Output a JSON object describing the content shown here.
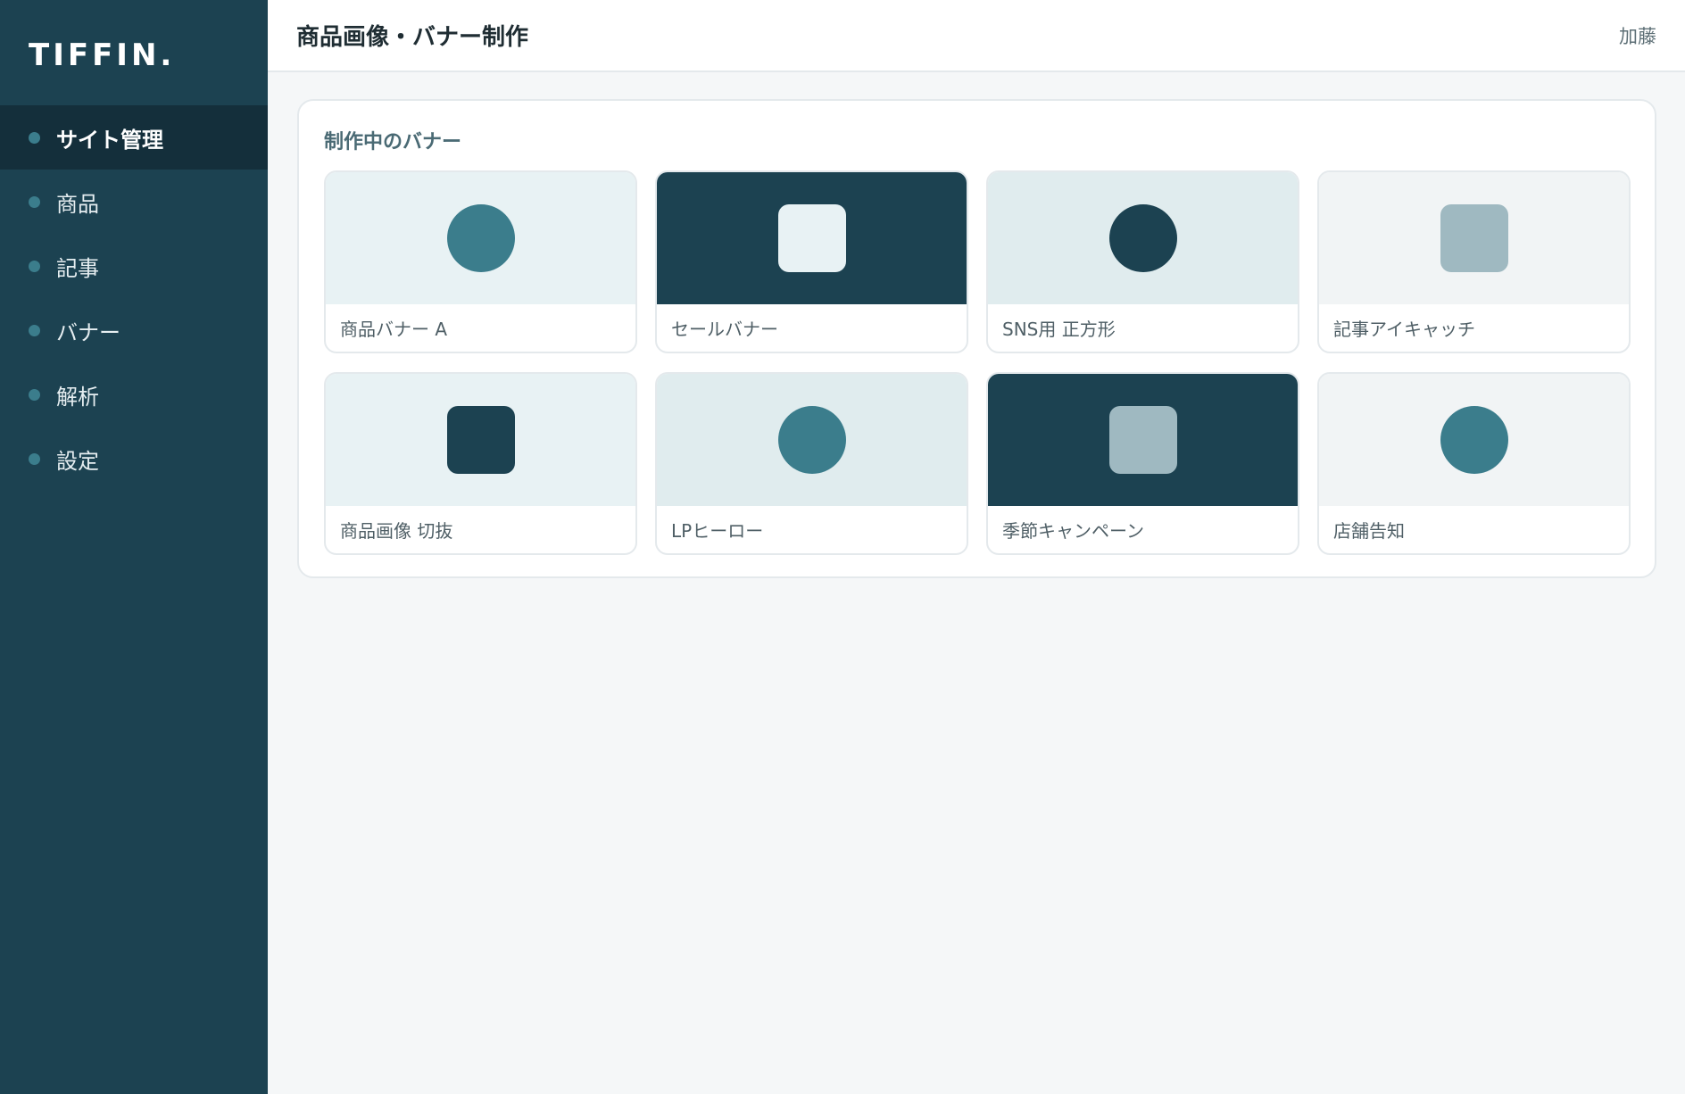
{
  "app": {
    "logo": "TIFFIN."
  },
  "sidebar": {
    "items": [
      {
        "label": "サイト管理",
        "active": true
      },
      {
        "label": "商品",
        "active": false
      },
      {
        "label": "記事",
        "active": false
      },
      {
        "label": "バナー",
        "active": false
      },
      {
        "label": "解析",
        "active": false
      },
      {
        "label": "設定",
        "active": false
      }
    ]
  },
  "header": {
    "title": "商品画像・バナー制作",
    "user": "加藤"
  },
  "panel": {
    "title": "制作中のバナー",
    "cards": [
      {
        "label": "商品バナー A",
        "bg": "#e8f2f4",
        "shape": "circle",
        "color": "#3b7d8c"
      },
      {
        "label": "セールバナー",
        "bg": "#1c4251",
        "shape": "square",
        "color": "#e8f2f4"
      },
      {
        "label": "SNS用 正方形",
        "bg": "#e0ecee",
        "shape": "circle",
        "color": "#1c4251"
      },
      {
        "label": "記事アイキャッチ",
        "bg": "#f1f4f5",
        "shape": "square",
        "color": "#9fb9c1"
      },
      {
        "label": "商品画像 切抜",
        "bg": "#e8f2f4",
        "shape": "square",
        "color": "#1c4251"
      },
      {
        "label": "LPヒーロー",
        "bg": "#e0ecee",
        "shape": "circle",
        "color": "#3b7d8c"
      },
      {
        "label": "季節キャンペーン",
        "bg": "#1c4251",
        "shape": "square",
        "color": "#9fb9c1"
      },
      {
        "label": "店舗告知",
        "bg": "#f1f4f5",
        "shape": "circle",
        "color": "#3b7d8c"
      }
    ]
  },
  "colors": {
    "sidebar_bg": "#1c4251",
    "sidebar_active": "#142f3b",
    "accent": "#3b7d8c"
  }
}
